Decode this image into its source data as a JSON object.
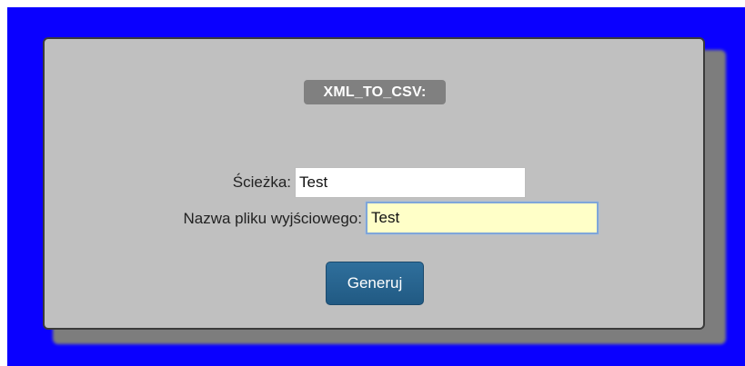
{
  "form": {
    "title": "XML_TO_CSV:",
    "path_label": "Ścieżka:",
    "path_value": "Test",
    "output_label": "Nazwa pliku wyjściowego:",
    "output_value": "Test",
    "generate_label": "Generuj"
  },
  "colors": {
    "background": "#0a00ff",
    "panel": "#c0c0c0",
    "badge": "#808080",
    "button": "#2a6591",
    "focused_input": "#ffffc8"
  }
}
